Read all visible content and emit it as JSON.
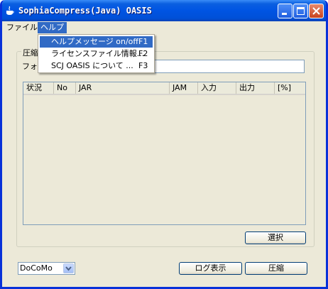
{
  "window": {
    "title": "SophiaCompress(Java) OASIS",
    "colors": {
      "titlebar": "#0054e3",
      "face": "#ece9d8",
      "highlight": "#316ac5",
      "close": "#c8431e"
    },
    "icons": {
      "app": "java-cup-icon",
      "minimize": "minimize-icon",
      "maximize": "maximize-icon",
      "close": "close-icon"
    }
  },
  "menubar": {
    "file": "ファイル",
    "help": "ヘルプ"
  },
  "help_menu": {
    "items": [
      {
        "label": "ヘルプメッセージ on/off",
        "shortcut": "F1"
      },
      {
        "label": "ライセンスファイル情報...",
        "shortcut": "F2"
      },
      {
        "label": "SCJ OASIS について ...",
        "shortcut": "F3"
      }
    ]
  },
  "compress_group": {
    "label": "圧縮",
    "folder_label": "フォ",
    "folder_value": ""
  },
  "table": {
    "columns": [
      "状況",
      "No",
      "JAR",
      "JAM",
      "入力",
      "出力",
      "[%]"
    ],
    "rows": []
  },
  "buttons": {
    "select": "選択",
    "log": "ログ表示",
    "compress": "圧縮"
  },
  "carrier_select": {
    "value": "DoCoMo",
    "arrow_icon": "chevron-down-icon"
  }
}
